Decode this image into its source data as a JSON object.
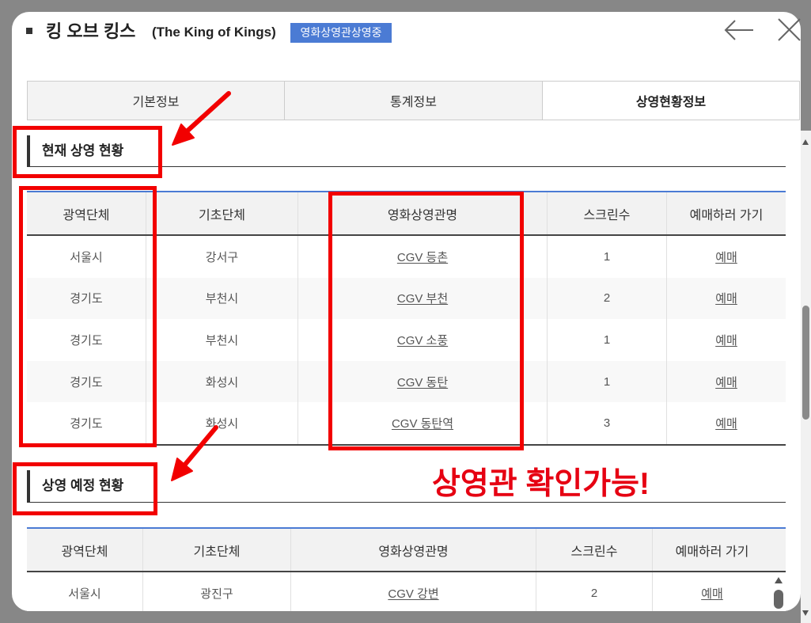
{
  "modal": {
    "title": "킹 오브 킹스",
    "title_en": "(The King of Kings)",
    "status_badge": "영화상영관상영중",
    "back_icon": "arrow-left-icon",
    "close_icon": "close-icon"
  },
  "tabs": [
    {
      "label": "기본정보",
      "active": false
    },
    {
      "label": "통계정보",
      "active": false
    },
    {
      "label": "상영현황정보",
      "active": true
    }
  ],
  "current_screening": {
    "heading": "현재 상영 현황",
    "columns": [
      "광역단체",
      "기초단체",
      "영화상영관명",
      "스크린수",
      "예매하러 가기"
    ],
    "rows": [
      {
        "region": "서울시",
        "district": "강서구",
        "theater": "CGV 등촌",
        "screens": 1,
        "booking": "예매"
      },
      {
        "region": "경기도",
        "district": "부천시",
        "theater": "CGV 부천",
        "screens": 2,
        "booking": "예매"
      },
      {
        "region": "경기도",
        "district": "부천시",
        "theater": "CGV 소풍",
        "screens": 1,
        "booking": "예매"
      },
      {
        "region": "경기도",
        "district": "화성시",
        "theater": "CGV 동탄",
        "screens": 1,
        "booking": "예매"
      },
      {
        "region": "경기도",
        "district": "화성시",
        "theater": "CGV 동탄역",
        "screens": 3,
        "booking": "예매"
      }
    ]
  },
  "upcoming_screening": {
    "heading": "상영 예정 현황",
    "columns": [
      "광역단체",
      "기초단체",
      "영화상영관명",
      "스크린수",
      "예매하러 가기"
    ],
    "rows": [
      {
        "region": "서울시",
        "district": "광진구",
        "theater": "CGV 강변",
        "screens": 2,
        "booking": "예매"
      }
    ]
  },
  "annotation": {
    "callout": "상영관 확인가능!"
  },
  "colors": {
    "accent": "#4b7bd4",
    "annotation_red": "#f20000",
    "callout_red": "#e60012",
    "header_bg": "#f2f2f2"
  }
}
